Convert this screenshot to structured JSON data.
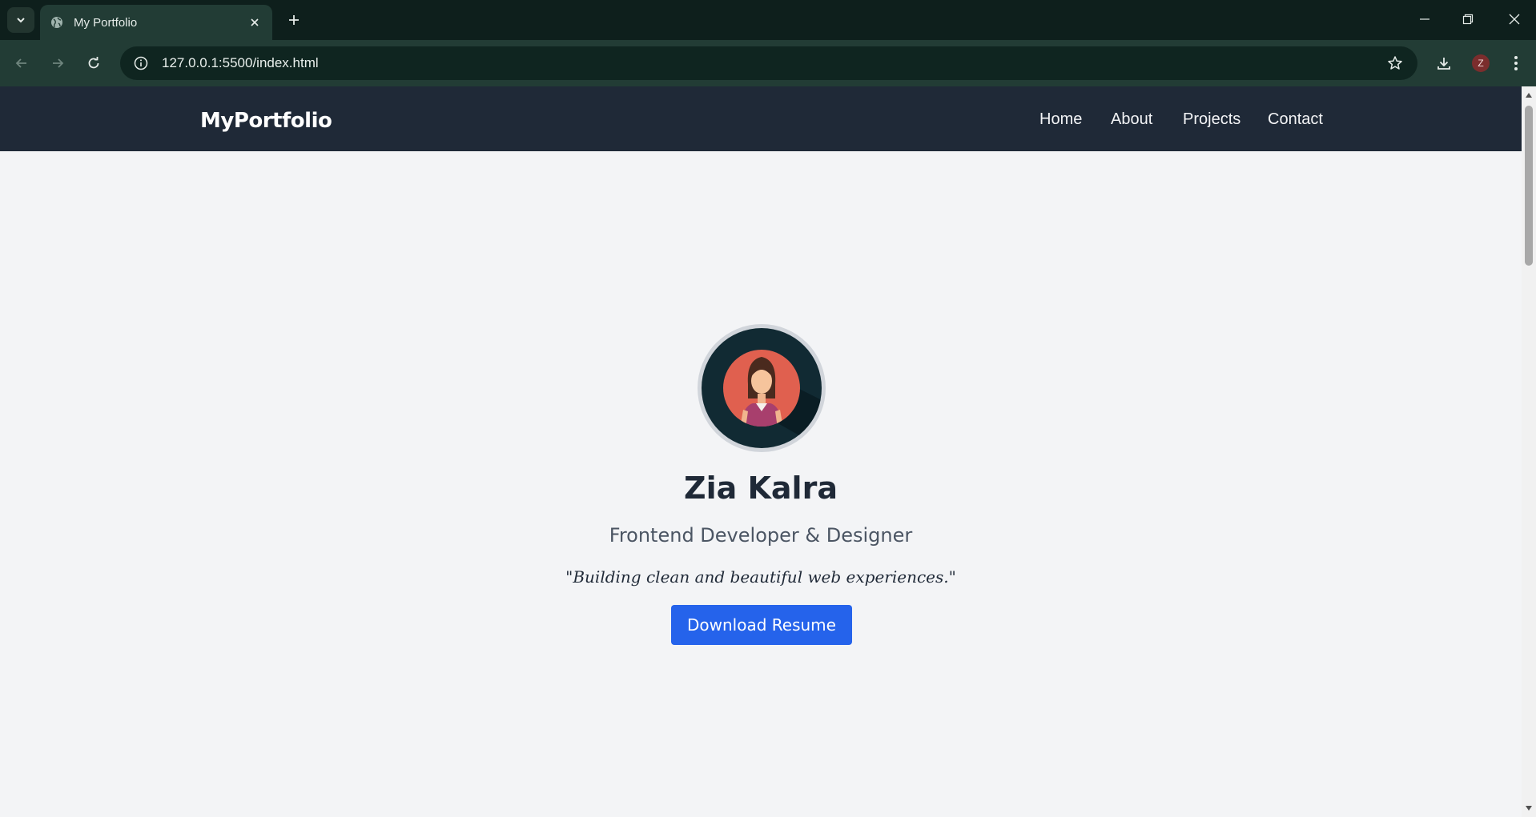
{
  "browser": {
    "tab_title": "My Portfolio",
    "url": "127.0.0.1:5500/index.html",
    "profile_initial": "Z"
  },
  "site": {
    "brand": "MyPortfolio",
    "nav": [
      "Home",
      "About",
      "Projects",
      "Contact"
    ]
  },
  "hero": {
    "name": "Zia Kalra",
    "role": "Frontend Developer & Designer",
    "quote": "\"Building clean and beautiful web experiences.\"",
    "button_label": "Download Resume"
  },
  "colors": {
    "nav_bg": "#1f2937",
    "page_bg": "#f3f4f6",
    "button_bg": "#2563eb",
    "chrome_bg": "#223c35"
  }
}
